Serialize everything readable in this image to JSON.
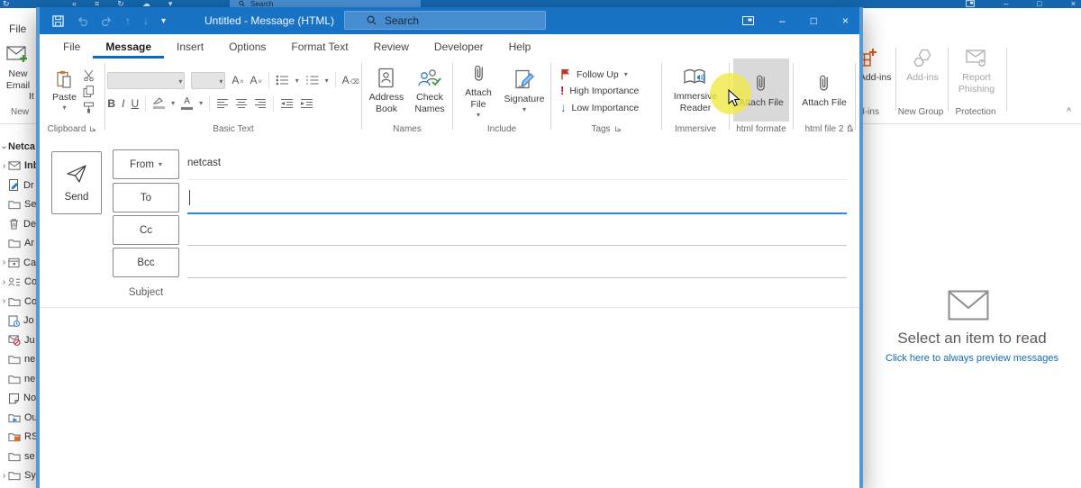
{
  "glyphs": {
    "dropdown": "▾",
    "up": "↑",
    "down": "↓",
    "back": "«",
    "menu": "≡",
    "sync": "↻",
    "cloud": "☁",
    "minimize": "–",
    "maximize": "□",
    "close": "×",
    "collapse": "^",
    "bold": "B",
    "italic": "I",
    "underline": "U",
    "font_a": "A",
    "high_importance_mark": "!",
    "low_importance_mark": "↓"
  },
  "main": {
    "top": {
      "search": "Search"
    },
    "file_tab": "File",
    "ribbon": {
      "new_email": "New Email",
      "new_items_fragment": "It",
      "group_new": "New",
      "get_addins": "Get Add-ins",
      "group_addins": "Add-ins",
      "addins": "Add-ins",
      "group_new_group": "New Group",
      "report_phishing": "Report Phishing",
      "group_protection": "Protection"
    },
    "sidebar": {
      "items": [
        {
          "chevron": "⌄",
          "label": "Netca"
        },
        {
          "chevron": "›",
          "label": "Inb"
        },
        {
          "chevron": "",
          "label": "Dr"
        },
        {
          "chevron": "",
          "label": "Se"
        },
        {
          "chevron": "",
          "label": "De"
        },
        {
          "chevron": "",
          "label": "Ar"
        },
        {
          "chevron": "›",
          "label": "Ca"
        },
        {
          "chevron": "›",
          "label": "Co"
        },
        {
          "chevron": "›",
          "label": "Co"
        },
        {
          "chevron": "",
          "label": "Jo"
        },
        {
          "chevron": "",
          "label": "Ju"
        },
        {
          "chevron": "",
          "label": "ne"
        },
        {
          "chevron": "",
          "label": "ne"
        },
        {
          "chevron": "",
          "label": "No"
        },
        {
          "chevron": "",
          "label": "Ou"
        },
        {
          "chevron": "",
          "label": "RS"
        },
        {
          "chevron": "",
          "label": "se"
        },
        {
          "chevron": "›",
          "label": "Sy"
        }
      ]
    },
    "reading_pane": {
      "title": "Select an item to read",
      "link": "Click here to always preview messages"
    }
  },
  "compose": {
    "title": "Untitled  -  Message (HTML)",
    "search": "Search",
    "tabs": [
      "File",
      "Message",
      "Insert",
      "Options",
      "Format Text",
      "Review",
      "Developer",
      "Help"
    ],
    "active_tab": "Message",
    "ribbon": {
      "paste": "Paste",
      "group_clipboard": "Clipboard",
      "group_basic_text": "Basic Text",
      "address_book": "Address Book",
      "check_names": "Check Names",
      "group_names": "Names",
      "attach_file": "Attach File",
      "signature": "Signature",
      "group_include": "Include",
      "follow_up": "Follow Up",
      "high_importance": "High Importance",
      "low_importance": "Low Importance",
      "group_tags": "Tags",
      "immersive_reader": "Immersive Reader",
      "group_immersive": "Immersive",
      "attach_file_html": "Attach File",
      "group_html_formate": "html formate",
      "attach_file_html2": "Attach File",
      "group_html_file_2": "html file 2"
    },
    "form": {
      "send": "Send",
      "from": "From",
      "from_value": "netcast",
      "to": "To",
      "to_value": "",
      "cc": "Cc",
      "bcc": "Bcc",
      "subject": "Subject"
    }
  }
}
